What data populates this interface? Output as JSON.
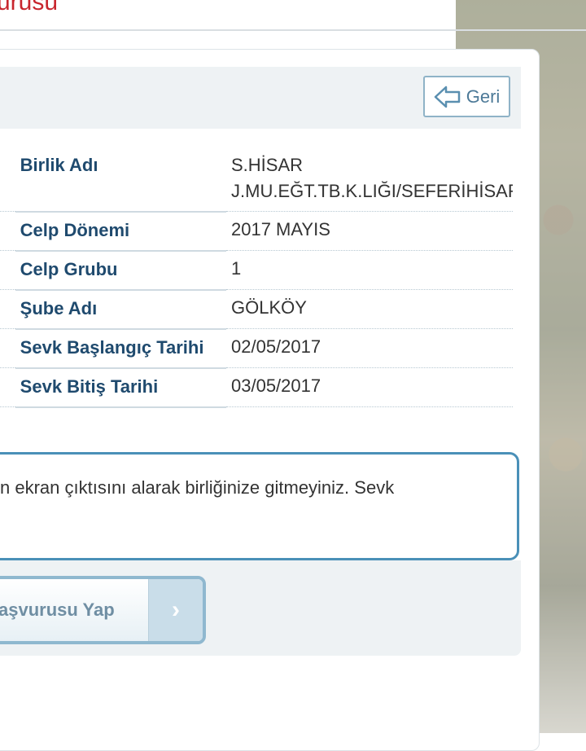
{
  "page": {
    "title": "urusu"
  },
  "header": {
    "back_label": "Geri"
  },
  "details": [
    {
      "label": "Birlik Adı",
      "value": "S.HİSAR J.MU.EĞT.TB.K.LIĞI/SEFERİHİSAR"
    },
    {
      "label": "Celp Dönemi",
      "value": "2017 MAYIS"
    },
    {
      "label": "Celp Grubu",
      "value": "1"
    },
    {
      "label": "Şube Adı",
      "value": "GÖLKÖY"
    },
    {
      "label": "Sevk Başlangıç Tarihi",
      "value": "02/05/2017"
    },
    {
      "label": "Sevk Bitiş Tarihi",
      "value": "03/05/2017"
    }
  ],
  "notice": {
    "text": "n ekran çıktısını alarak birliğinize gitmeyiniz. Sevk"
  },
  "footer": {
    "apply_label": "aşvurusu Yap",
    "arrow_glyph": "›"
  },
  "colors": {
    "title_red": "#c8262e",
    "label_blue": "#1f4a6e",
    "accent_blue": "#4a90b8"
  }
}
